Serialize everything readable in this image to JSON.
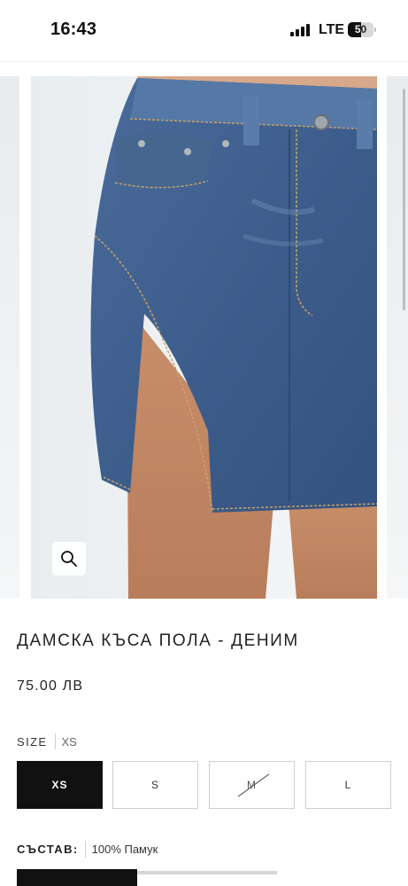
{
  "status_bar": {
    "time": "16:43",
    "network": "LTE",
    "battery": "50"
  },
  "gallery": {
    "image": "denim-mini-skirt-photo",
    "zoom_icon": "search-icon"
  },
  "product": {
    "title": "ДАМСКА КЪСА ПОЛА - ДЕНИМ",
    "price": "75.00 ЛВ"
  },
  "size": {
    "label": "SIZE",
    "selected_value": "XS",
    "options": [
      {
        "label": "XS",
        "state": "selected"
      },
      {
        "label": "S",
        "state": "available"
      },
      {
        "label": "M",
        "state": "unavailable"
      },
      {
        "label": "L",
        "state": "available"
      }
    ]
  },
  "composition": {
    "label": "СЪСТАВ:",
    "value": "100% Памук"
  },
  "colors": {
    "selected_bg": "#111111",
    "border": "#cfcfcf",
    "denim": "#3f5f8e"
  }
}
